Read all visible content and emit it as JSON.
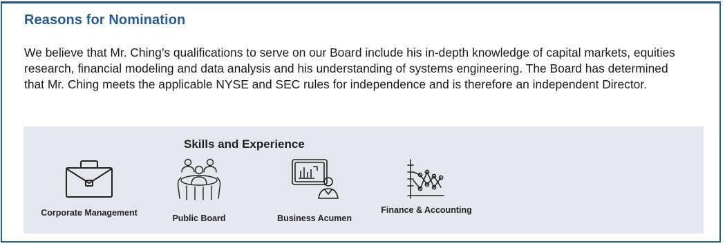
{
  "section": {
    "heading": "Reasons for Nomination",
    "paragraph": "We believe that Mr. Ching’s qualifications to serve on our Board include his in-depth knowledge of capital markets, equities research, financial modeling and data analysis and his understanding of systems engineering. The Board has determined that Mr. Ching meets the applicable NYSE and SEC rules for independence and is therefore an independent Director."
  },
  "skills": {
    "title": "Skills and Experience",
    "items": [
      {
        "label": "Corporate Management",
        "icon": "briefcase-icon"
      },
      {
        "label": "Public Board",
        "icon": "board-meeting-icon"
      },
      {
        "label": "Business Acumen",
        "icon": "presentation-chart-icon"
      },
      {
        "label": "Finance & Accounting",
        "icon": "line-chart-icon"
      }
    ]
  },
  "colors": {
    "heading": "#2a5a8a",
    "border": "#2a5a8a",
    "panel_background": "#e3e8ef"
  }
}
